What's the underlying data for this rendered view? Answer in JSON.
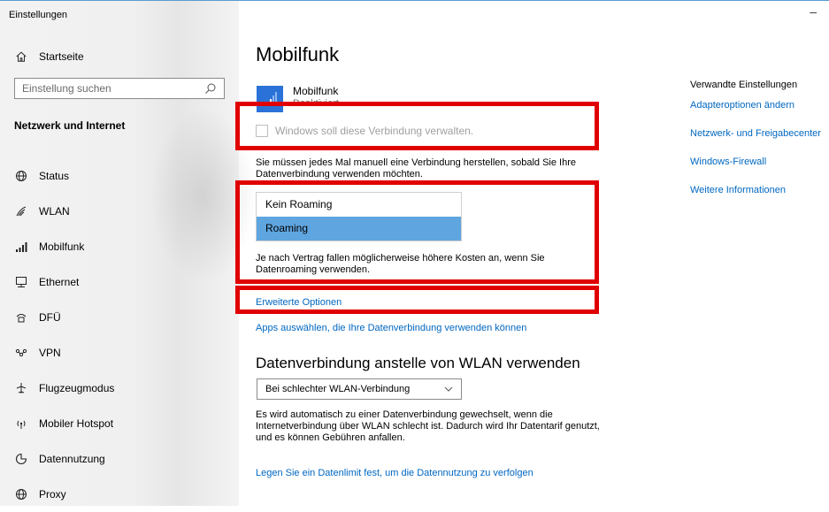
{
  "window": {
    "title": "Einstellungen",
    "minimize_glyph": "–"
  },
  "sidebar": {
    "home_label": "Startseite",
    "search_placeholder": "Einstellung suchen",
    "section_title": "Netzwerk und Internet",
    "items": [
      {
        "label": "Status",
        "icon": "status-globe-icon"
      },
      {
        "label": "WLAN",
        "icon": "wifi-icon"
      },
      {
        "label": "Mobilfunk",
        "icon": "cellular-signal-icon"
      },
      {
        "label": "Ethernet",
        "icon": "ethernet-icon"
      },
      {
        "label": "DFÜ",
        "icon": "dialup-icon"
      },
      {
        "label": "VPN",
        "icon": "vpn-icon"
      },
      {
        "label": "Flugzeugmodus",
        "icon": "airplane-icon"
      },
      {
        "label": "Mobiler Hotspot",
        "icon": "hotspot-icon"
      },
      {
        "label": "Datennutzung",
        "icon": "data-usage-icon"
      },
      {
        "label": "Proxy",
        "icon": "proxy-globe-icon"
      }
    ]
  },
  "main": {
    "title": "Mobilfunk",
    "connection": {
      "name": "Mobilfunk",
      "status": "Deaktiviert"
    },
    "manage_checkbox": {
      "label": "Windows soll diese Verbindung verwalten.",
      "checked": false
    },
    "manage_description": "Sie müssen jedes Mal manuell eine Verbindung herstellen, sobald Sie Ihre Datenverbindung verwenden möchten.",
    "roaming_options": [
      "Kein Roaming",
      "Roaming"
    ],
    "roaming_selected": "Roaming",
    "roaming_description": "Je nach Vertrag fallen möglicherweise höhere Kosten an, wenn Sie Datenroaming verwenden.",
    "advanced_link": "Erweiterte Optionen",
    "apps_link": "Apps auswählen, die Ihre Datenverbindung verwenden können",
    "wlan_heading": "Datenverbindung anstelle von WLAN verwenden",
    "wlan_select_value": "Bei schlechter WLAN-Verbindung",
    "wlan_description": "Es wird automatisch zu einer Datenverbindung gewechselt, wenn die Internetverbindung über WLAN schlecht ist. Dadurch wird Ihr Datentarif genutzt, und es können Gebühren anfallen.",
    "data_limit_link": "Legen Sie ein Datenlimit fest, um die Datennutzung zu verfolgen"
  },
  "related": {
    "title": "Verwandte Einstellungen",
    "links": [
      "Adapteroptionen ändern",
      "Netzwerk- und Freigabecenter",
      "Windows-Firewall",
      "Weitere Informationen"
    ]
  },
  "colors": {
    "accent": "#0067c0",
    "tile": "#2b72d8",
    "selected_option": "#5fa6e0",
    "highlight": "#e00000"
  }
}
